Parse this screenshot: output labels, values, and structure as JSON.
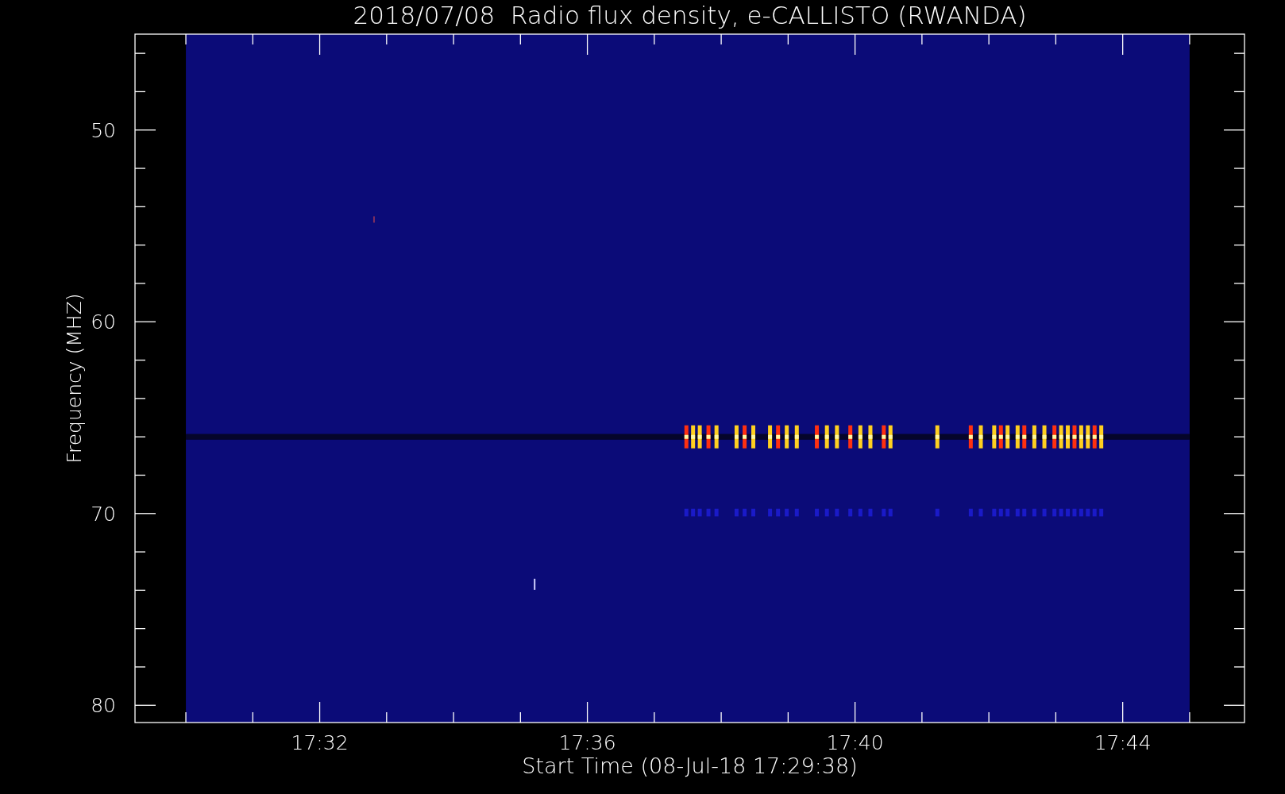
{
  "plot": {
    "title": "2018/07/08  Radio flux density, e-CALLISTO (RWANDA)",
    "xlabel": "Start Time (08-Jul-18 17:29:38)",
    "ylabel": "Frequency (MHZ)",
    "xticks": [
      "17:32",
      "17:36",
      "17:40",
      "17:44"
    ],
    "yticks": [
      "50",
      "60",
      "70",
      "80"
    ]
  }
}
